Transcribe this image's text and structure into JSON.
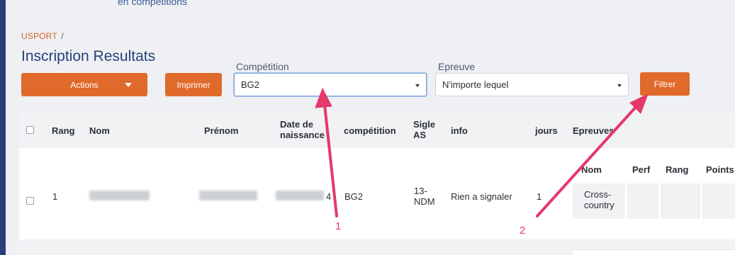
{
  "top_cut_text": "en compétitions",
  "breadcrumb": {
    "root": "USPORT",
    "separator": "/"
  },
  "page_title": "Inscription Resultats",
  "toolbar": {
    "actions_label": "Actions",
    "print_label": "Imprimer",
    "filter_label": "Filtrer"
  },
  "filters": {
    "competition": {
      "label": "Compétition",
      "value": "BG2"
    },
    "epreuve": {
      "label": "Epreuve",
      "value": "N'importe lequel"
    }
  },
  "table": {
    "headers": {
      "rang": "Rang",
      "nom": "Nom",
      "prenom": "Prénom",
      "date_naissance_1": "Date de",
      "date_naissance_2": "naissance",
      "competition": "compétition",
      "sigle_1": "Sigle",
      "sigle_2": "AS",
      "info": "info",
      "jours": "jours",
      "epreuves": "Epreuves"
    },
    "row": {
      "rang": "1",
      "date_suffix": "4",
      "competition": "BG2",
      "sigle_1": "13-",
      "sigle_2": "NDM",
      "info": "Rien a signaler",
      "jours": "1"
    },
    "epreuves_table": {
      "headers": {
        "nom": "Nom",
        "perf": "Perf",
        "rang": "Rang",
        "points": "Points"
      },
      "row": {
        "nom_1": "Cross-",
        "nom_2": "country"
      }
    }
  },
  "annotations": {
    "marker_1": "1",
    "marker_2": "2"
  },
  "colors": {
    "accent": "#e0692c",
    "title": "#27407a",
    "annotation": "#e5386b"
  }
}
